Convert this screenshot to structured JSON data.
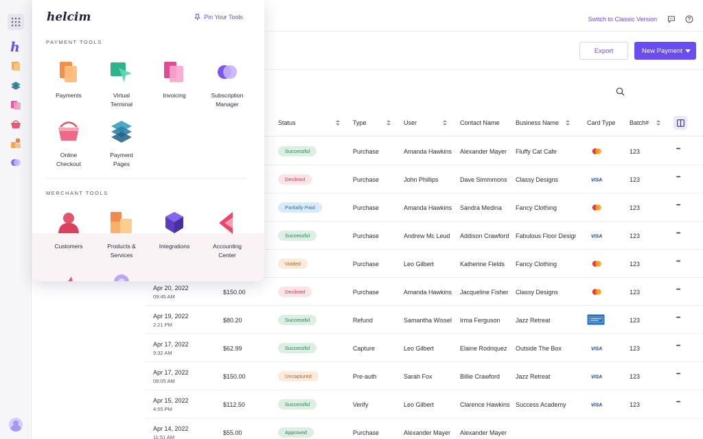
{
  "app": {
    "switch_link": "Switch to Classic Version"
  },
  "actions": {
    "export_label": "Export",
    "new_payment_label": "New Payment"
  },
  "tools_panel": {
    "logo_text": "helcim",
    "pin_label": "Pin Your Tools",
    "payment_section_title": "PAYMENT TOOLS",
    "merchant_section_title": "MERCHANT TOOLS",
    "payment_tools": [
      {
        "line1": "Payments",
        "line2": ""
      },
      {
        "line1": "Virtual",
        "line2": "Terminal"
      },
      {
        "line1": "Invoicing",
        "line2": ""
      },
      {
        "line1": "Subscription",
        "line2": "Manager"
      },
      {
        "line1": "Online",
        "line2": "Checkout"
      },
      {
        "line1": "Payment",
        "line2": "Pages"
      }
    ],
    "merchant_tools": [
      {
        "line1": "Customers",
        "line2": ""
      },
      {
        "line1": "Products &",
        "line2": "Services"
      },
      {
        "line1": "Integrations",
        "line2": ""
      },
      {
        "line1": "Accounting",
        "line2": "Center"
      }
    ]
  },
  "table": {
    "headers": {
      "status": "Status",
      "type": "Type",
      "user": "User",
      "contact": "Contact Name",
      "business": "Business Name",
      "card_type": "Card Type",
      "batch": "Batch#"
    },
    "rows": [
      {
        "date": "",
        "time": "",
        "amount": "",
        "status": "Successful",
        "type": "Purchase",
        "user": "Amanda Hawkins",
        "contact": "Alexander Mayer",
        "business": "Fluffy Cat Cafe",
        "card": "mastercard",
        "batch": "123"
      },
      {
        "date": "",
        "time": "",
        "amount": "",
        "status": "Declined",
        "type": "Purchase",
        "user": "John Phillips",
        "contact": "Dave Simmmons",
        "business": "Classy Designs",
        "card": "visa",
        "batch": "123"
      },
      {
        "date": "",
        "time": "",
        "amount": "",
        "status": "Partially Paid",
        "type": "Purchase",
        "user": "Amanda Hawkins",
        "contact": "Sandra Medina",
        "business": "Fancy Clothing",
        "card": "mastercard",
        "batch": "123"
      },
      {
        "date": "",
        "time": "",
        "amount": "",
        "status": "Successful",
        "type": "Purchase",
        "user": "Andrew Mc Leud",
        "contact": "Addison Crawford",
        "business": "Fabulous Floor Designs",
        "card": "visa",
        "batch": "123"
      },
      {
        "date": "",
        "time": "",
        "amount": "",
        "status": "Voided",
        "type": "Purchase",
        "user": "Leo Gilbert",
        "contact": "Katherine Fields",
        "business": "Fancy Clothing",
        "card": "mastercard",
        "batch": "123"
      },
      {
        "date": "Apr 20, 2022",
        "time": "09:45 AM",
        "amount": "$150.00",
        "status": "Declined",
        "type": "Purchase",
        "user": "Amanda Hawkins",
        "contact": "Jacqueline Fisher",
        "business": "Classy Designs",
        "card": "mastercard",
        "batch": "123"
      },
      {
        "date": "Apr 19, 2022",
        "time": "2:21 PM",
        "amount": "$80.20",
        "status": "Successful",
        "type": "Refund",
        "user": "Samantha Wissel",
        "contact": "Irma Ferguson",
        "business": "Jazz Retreat",
        "card": "amex",
        "batch": "123"
      },
      {
        "date": "Apr 17, 2022",
        "time": "9:32 AM",
        "amount": "$62.99",
        "status": "Successful",
        "type": "Capture",
        "user": "Leo Gilbert",
        "contact": "Elaine Rodriquez",
        "business": "Outside The Box",
        "card": "visa",
        "batch": "123"
      },
      {
        "date": "Apr 17, 2022",
        "time": "08:05 AM",
        "amount": "$150.00",
        "status": "Uncaptured",
        "type": "Pre-auth",
        "user": "Sarah Fox",
        "contact": "Billie Crawford",
        "business": "Jazz Retreat",
        "card": "visa",
        "batch": "123"
      },
      {
        "date": "Apr 15, 2022",
        "time": "4:55 PM",
        "amount": "$112.50",
        "status": "Successful",
        "type": "Verify",
        "user": "Leo Gilbert",
        "contact": "Clarence Hawkins",
        "business": "Success Academy",
        "card": "visa",
        "batch": "123"
      },
      {
        "date": "Apr 14, 2022",
        "time": "11:51 AM",
        "amount": "$55.00",
        "status": "Approved",
        "type": "Purchase",
        "user": "Alexander Mayer",
        "contact": "Alexander Mayer",
        "business": "",
        "card": "",
        "batch": ""
      }
    ]
  },
  "colors": {
    "accent": "#6a4cf0",
    "success_bg": "#dcefe3",
    "declined_bg": "#fbe3e6",
    "partial_bg": "#d8ebfa",
    "voided_bg": "#fdeadb"
  }
}
